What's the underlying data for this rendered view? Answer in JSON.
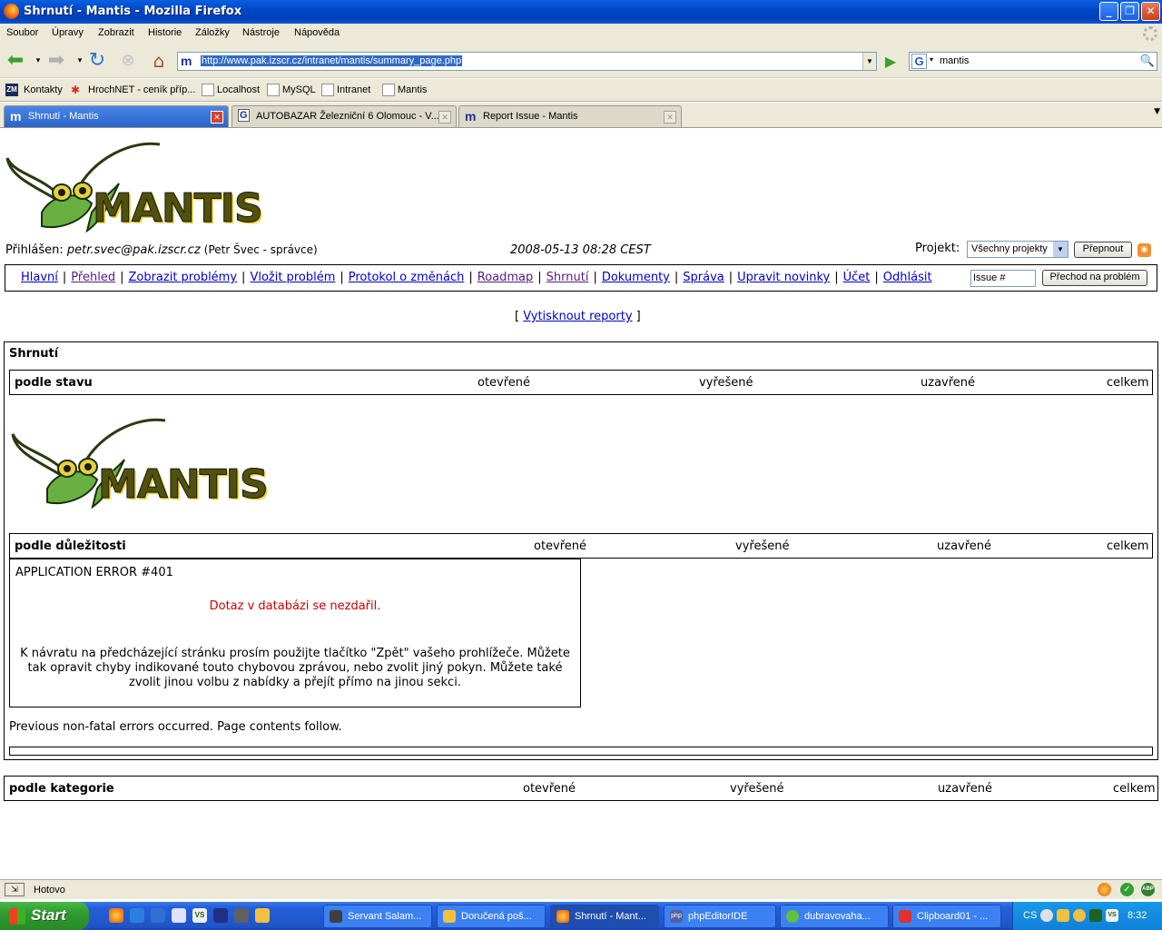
{
  "window": {
    "title": "Shrnutí - Mantis - Mozilla Firefox"
  },
  "menubar": [
    "Soubor",
    "Úpravy",
    "Zobrazit",
    "Historie",
    "Záložky",
    "Nástroje",
    "Nápověda"
  ],
  "toolbar": {
    "url": "http://www.pak.izscr.cz/intranet/mantis/summary_page.php",
    "search_engine": "G",
    "search_value": "mantis"
  },
  "bookmarks": [
    "Kontakty",
    "HrochNET - ceník příp...",
    "Localhost",
    "MySQL",
    "Intranet",
    "Mantis"
  ],
  "tabs": [
    {
      "label": "Shrnutí - Mantis",
      "icon": "m"
    },
    {
      "label": "AUTOBAZAR Železniční 6 Olomouc - V...",
      "icon": "G"
    },
    {
      "label": "Report Issue - Mantis",
      "icon": "m"
    }
  ],
  "page": {
    "logo_text": "MANTIS",
    "user_prefix": "Přihlášen:",
    "user_email": "petr.svec@pak.izscr.cz",
    "user_name": "(Petr Švec - správce)",
    "datetime": "2008-05-13 08:28 CEST",
    "project_label": "Projekt:",
    "project_value": "Všechny projekty",
    "switch_button": "Přepnout",
    "nav": [
      "Hlavní",
      "Přehled",
      "Zobrazit problémy",
      "Vložit problém",
      "Protokol o změnách",
      "Roadmap",
      "Shrnutí",
      "Dokumenty",
      "Správa",
      "Upravit novinky",
      "Účet",
      "Odhlásit"
    ],
    "issue_placeholder": "Issue #",
    "goto_button": "Přechod na problém",
    "print_link": "Vytisknout reporty",
    "summary_title": "Shrnutí",
    "columns": [
      "otevřené",
      "vyřešené",
      "uzavřené",
      "celkem"
    ],
    "by_status": "podle stavu",
    "by_severity": "podle důležitosti",
    "by_category": "podle kategorie",
    "error_title": "APPLICATION ERROR #401",
    "error_message": "Dotaz v databázi se nezdařil.",
    "error_body": "K návratu na předcházející stránku prosím použijte tlačítko \"Zpět\" vašeho prohlížeče. Můžete tak opravit chyby indikované touto chybovou zprávou, nebo zvolit jiný pokyn. Můžete také zvolit jinou volbu z nabídky a přejít přímo na jinou sekci.",
    "prev_errors": "Previous non-fatal errors occurred. Page contents follow."
  },
  "statusbar": {
    "text": "Hotovo"
  },
  "taskbar": {
    "start": "Start",
    "items": [
      "Servant Salam...",
      "Doručená poš...",
      "Shrnutí - Mant...",
      "phpEditorIDE",
      "dubravovaha...",
      "Clipboard01 - ..."
    ],
    "lang": "CS",
    "clock": "8:32"
  }
}
